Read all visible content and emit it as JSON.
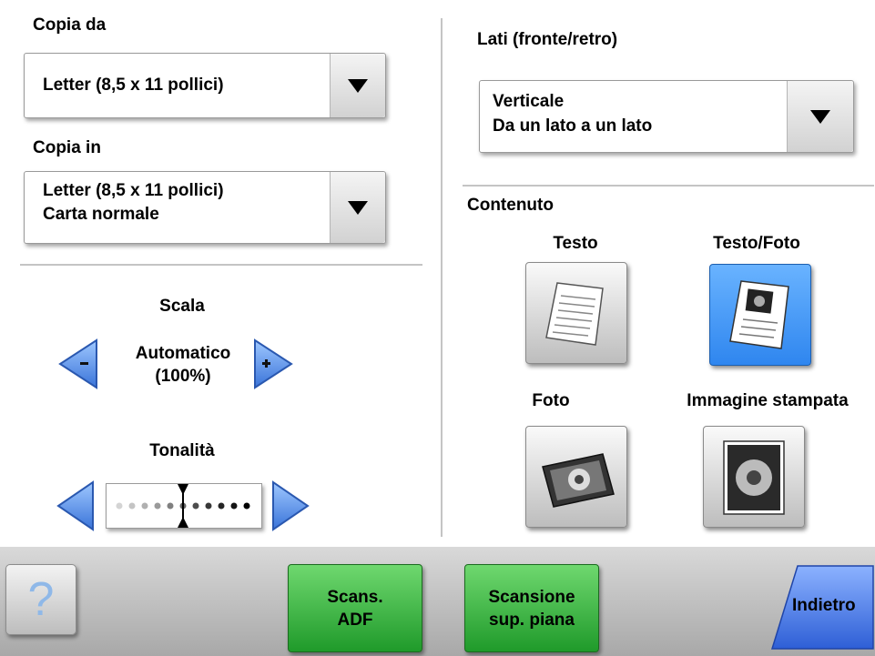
{
  "copy_from": {
    "label": "Copia da",
    "value_line1": "Letter (8,5 x 11 pollici)"
  },
  "copy_to": {
    "label": "Copia in",
    "value_line1": "Letter (8,5 x 11 pollici)",
    "value_line2": "Carta normale"
  },
  "scale": {
    "label": "Scala",
    "value_line1": "Automatico",
    "value_line2": "(100%)"
  },
  "darkness": {
    "label": "Tonalità",
    "level": 0.5
  },
  "sides": {
    "label": "Lati (fronte/retro)",
    "value_line1": "Verticale",
    "value_line2": "Da un lato a un lato"
  },
  "content": {
    "label": "Contenuto",
    "options": [
      {
        "label": "Testo",
        "selected": false
      },
      {
        "label": "Testo/Foto",
        "selected": true
      },
      {
        "label": "Foto",
        "selected": false
      },
      {
        "label": "Immagine stampata",
        "selected": false
      }
    ]
  },
  "bottom": {
    "scan_adf_line1": "Scans.",
    "scan_adf_line2": "ADF",
    "scan_flatbed_line1": "Scansione",
    "scan_flatbed_line2": "sup. piana",
    "back": "Indietro",
    "help_glyph": "?"
  },
  "colors": {
    "selected": "#3a8ff5",
    "go": "#2aa534",
    "back": "#3f73e6"
  }
}
